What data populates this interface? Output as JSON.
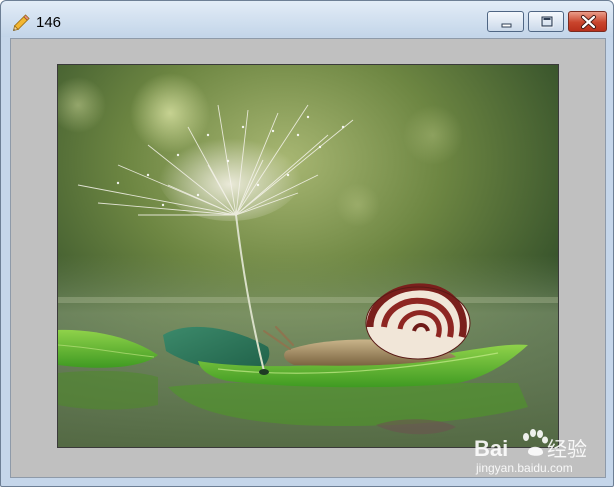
{
  "window": {
    "title": "146",
    "app_icon": "pencil-icon",
    "controls": {
      "minimize": "minimize-icon",
      "maximize": "maximize-icon",
      "close": "close-icon"
    }
  },
  "image": {
    "alt": "146"
  },
  "watermark": {
    "brand_latin": "Bai",
    "brand_cjk": "经验",
    "url": "jingyan.baidu.com"
  },
  "colors": {
    "titlebar_top": "#e2ecf7",
    "titlebar_bottom": "#c3d5e9",
    "client_bg": "#c0c0c0",
    "close_button": "#c9442c"
  }
}
